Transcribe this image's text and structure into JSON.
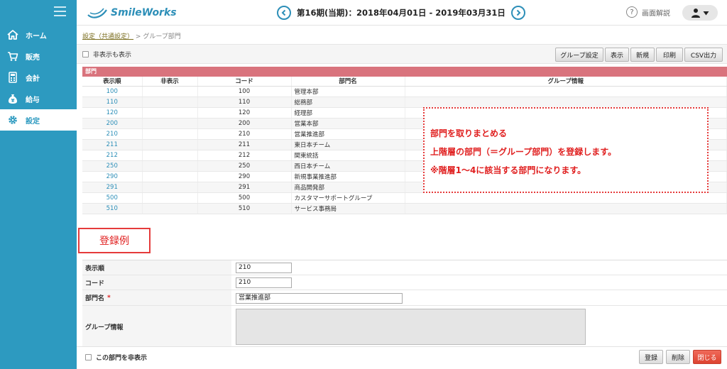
{
  "sidebar": {
    "items": [
      {
        "label": "ホーム",
        "icon": "home-icon"
      },
      {
        "label": "販売",
        "icon": "cart-icon"
      },
      {
        "label": "会計",
        "icon": "calculator-icon"
      },
      {
        "label": "給与",
        "icon": "money-bag-icon"
      },
      {
        "label": "設定",
        "icon": "gear-icon"
      }
    ],
    "active": "設定"
  },
  "header": {
    "logo": "SmileWorks",
    "period": "第16期(当期)：2018年04月01日 - 2019年03月31日",
    "help_label": "画面解説",
    "help_icon_text": "?"
  },
  "breadcrumb": {
    "link": "設定（共通設定）",
    "separator": ">",
    "current": "グループ部門"
  },
  "toolbar": {
    "show_hidden_label": "非表示も表示",
    "buttons": [
      "グループ設定",
      "表示",
      "新規",
      "印刷",
      "CSV出力"
    ]
  },
  "section": {
    "title": "部門"
  },
  "table": {
    "columns": [
      "表示順",
      "非表示",
      "コード",
      "部門名",
      "グループ情報"
    ],
    "rows": [
      {
        "order": "100",
        "hidden": "",
        "code": "100",
        "name": "管理本部",
        "group": ""
      },
      {
        "order": "110",
        "hidden": "",
        "code": "110",
        "name": "総務部",
        "group": ""
      },
      {
        "order": "120",
        "hidden": "",
        "code": "120",
        "name": "経理部",
        "group": ""
      },
      {
        "order": "200",
        "hidden": "",
        "code": "200",
        "name": "営業本部",
        "group": ""
      },
      {
        "order": "210",
        "hidden": "",
        "code": "210",
        "name": "営業推進部",
        "group": ""
      },
      {
        "order": "211",
        "hidden": "",
        "code": "211",
        "name": "東日本チーム",
        "group": ""
      },
      {
        "order": "212",
        "hidden": "",
        "code": "212",
        "name": "関東統括",
        "group": ""
      },
      {
        "order": "250",
        "hidden": "",
        "code": "250",
        "name": "西日本チーム",
        "group": ""
      },
      {
        "order": "290",
        "hidden": "",
        "code": "290",
        "name": "新規事業推進部",
        "group": ""
      },
      {
        "order": "291",
        "hidden": "",
        "code": "291",
        "name": "商品開発部",
        "group": ""
      },
      {
        "order": "500",
        "hidden": "",
        "code": "500",
        "name": "カスタマーサポートグループ",
        "group": ""
      },
      {
        "order": "510",
        "hidden": "",
        "code": "510",
        "name": "サービス事務局",
        "group": ""
      }
    ]
  },
  "annotation": {
    "lines": [
      "部門を取りまとめる",
      "上階層の部門（＝グループ部門）を登録します。",
      "※階層1〜4に該当する部門になります。"
    ]
  },
  "example_label": "登録例",
  "form": {
    "order_label": "表示順",
    "order_value": "210",
    "code_label": "コード",
    "code_value": "210",
    "name_label": "部門名",
    "required_mark": "*",
    "name_value": "営業推進部",
    "group_label": "グループ情報",
    "group_value": "",
    "hide_label": "この部門を非表示"
  },
  "footer_buttons": {
    "register": "登録",
    "delete": "削除",
    "close": "閉じる"
  },
  "colors": {
    "sidebar": "#2d9ac0",
    "section_header": "#d9737d",
    "annotation": "#e02020",
    "close_button": "#dd4330"
  }
}
